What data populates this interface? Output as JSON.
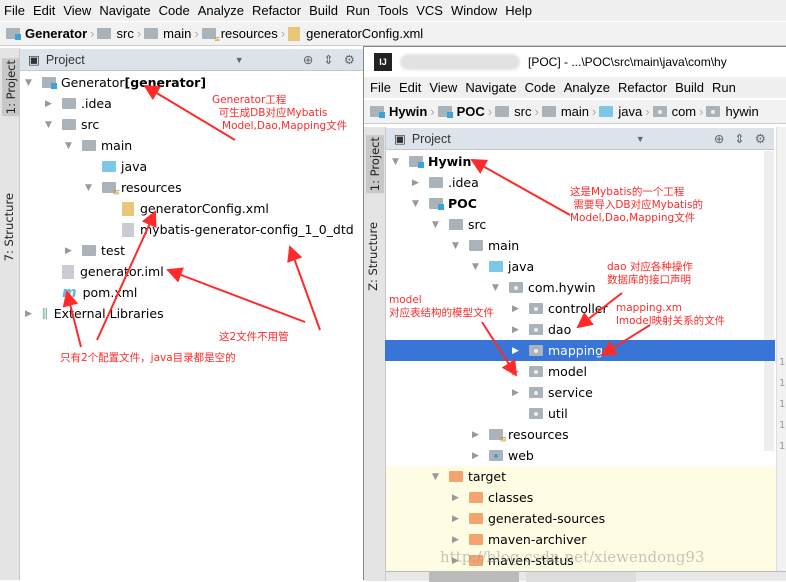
{
  "left": {
    "menu": [
      "File",
      "Edit",
      "View",
      "Navigate",
      "Code",
      "Analyze",
      "Refactor",
      "Build",
      "Run",
      "Tools",
      "VCS",
      "Window",
      "Help"
    ],
    "breadcrumb": [
      {
        "label": "Generator",
        "icon": "module",
        "bold": true
      },
      {
        "label": "src",
        "icon": "folder"
      },
      {
        "label": "main",
        "icon": "folder"
      },
      {
        "label": "resources",
        "icon": "res"
      },
      {
        "label": "generatorConfig.xml",
        "icon": "xml"
      }
    ],
    "panel_title": "Project",
    "side_tabs": [
      "1: Project",
      "7: Structure"
    ],
    "tree": [
      {
        "label": "Generator",
        "suffix": " [generator]",
        "level": 0,
        "state": "open",
        "icon": "mod"
      },
      {
        "label": ".idea",
        "level": 1,
        "state": "closed",
        "icon": "folder"
      },
      {
        "label": "src",
        "level": 1,
        "state": "open",
        "icon": "folder"
      },
      {
        "label": "main",
        "level": 2,
        "state": "open",
        "icon": "folder"
      },
      {
        "label": "java",
        "level": 3,
        "state": "none",
        "icon": "blue"
      },
      {
        "label": "resources",
        "level": 3,
        "state": "open",
        "icon": "res"
      },
      {
        "label": "generatorConfig.xml",
        "level": 4,
        "state": "none",
        "icon": "xml"
      },
      {
        "label": "mybatis-generator-config_1_0_dtd",
        "level": 4,
        "state": "none",
        "icon": "file"
      },
      {
        "label": "test",
        "level": 2,
        "state": "closed",
        "icon": "folder"
      },
      {
        "label": "generator.iml",
        "level": 1,
        "state": "none",
        "icon": "file"
      },
      {
        "label": "pom.xml",
        "level": 1,
        "state": "none",
        "icon": "maven"
      },
      {
        "label": "External Libraries",
        "level": 0,
        "state": "closed",
        "icon": "libs"
      }
    ]
  },
  "right": {
    "title": "[POC] - ...\\POC\\src\\main\\java\\com\\hy",
    "menu": [
      "File",
      "Edit",
      "View",
      "Navigate",
      "Code",
      "Analyze",
      "Refactor",
      "Build",
      "Run"
    ],
    "breadcrumb": [
      {
        "label": "Hywin",
        "icon": "module",
        "bold": true
      },
      {
        "label": "POC",
        "icon": "module",
        "bold": true
      },
      {
        "label": "src",
        "icon": "folder"
      },
      {
        "label": "main",
        "icon": "folder"
      },
      {
        "label": "java",
        "icon": "blue"
      },
      {
        "label": "com",
        "icon": "pkg"
      },
      {
        "label": "hywin",
        "icon": "pkg"
      }
    ],
    "panel_title": "Project",
    "side_tabs": [
      "1: Project",
      "Z: Structure"
    ],
    "tree": [
      {
        "label": "Hywin",
        "level": 0,
        "state": "open",
        "icon": "mod",
        "bold": true
      },
      {
        "label": ".idea",
        "level": 1,
        "state": "closed",
        "icon": "folder"
      },
      {
        "label": "POC",
        "level": 1,
        "state": "open",
        "icon": "mod",
        "bold": true
      },
      {
        "label": "src",
        "level": 2,
        "state": "open",
        "icon": "folder"
      },
      {
        "label": "main",
        "level": 3,
        "state": "open",
        "icon": "folder"
      },
      {
        "label": "java",
        "level": 4,
        "state": "open",
        "icon": "blue"
      },
      {
        "label": "com.hywin",
        "level": 5,
        "state": "open",
        "icon": "pkg"
      },
      {
        "label": "controller",
        "level": 6,
        "state": "closed",
        "icon": "pkg"
      },
      {
        "label": "dao",
        "level": 6,
        "state": "closed",
        "icon": "pkg"
      },
      {
        "label": "mapping",
        "level": 6,
        "state": "closed",
        "icon": "pkg",
        "selected": true
      },
      {
        "label": "model",
        "level": 6,
        "state": "closed",
        "icon": "pkg"
      },
      {
        "label": "service",
        "level": 6,
        "state": "closed",
        "icon": "pkg"
      },
      {
        "label": "util",
        "level": 6,
        "state": "none",
        "icon": "pkg"
      },
      {
        "label": "resources",
        "level": 4,
        "state": "closed",
        "icon": "res"
      },
      {
        "label": "web",
        "level": 4,
        "state": "closed",
        "icon": "web"
      },
      {
        "label": "target",
        "level": 2,
        "state": "open",
        "icon": "orange",
        "excluded": true
      },
      {
        "label": "classes",
        "level": 3,
        "state": "closed",
        "icon": "orange",
        "excluded": true
      },
      {
        "label": "generated-sources",
        "level": 3,
        "state": "closed",
        "icon": "orange",
        "excluded": true
      },
      {
        "label": "maven-archiver",
        "level": 3,
        "state": "closed",
        "icon": "orange",
        "excluded": true
      },
      {
        "label": "maven-status",
        "level": 3,
        "state": "closed",
        "icon": "orange",
        "excluded": true
      }
    ],
    "gutter": [
      "1",
      "1",
      "1",
      "1",
      "1"
    ]
  },
  "annotations": {
    "generator": "Generator工程\n  可生成DB对应Mybatis\n   Model,Dao,Mapping文件",
    "ignore": "这2文件不用管",
    "only_two": "只有2个配置文件，java目录都是空的",
    "mybatis": "这是Mybatis的一个工程\n 需要导入DB对应Mybatis的\nModel,Dao,Mapping文件",
    "dao": "dao 对应各种操作\n数据库的接口声明",
    "model": "model\n对应表结构的模型文件",
    "mapping": "mapping.xm\nlmodel映射关系的文件"
  },
  "watermark": "http://blog.csdn.net/xiewendong93",
  "colors": {
    "annotation": "#ff2a2a",
    "selection": "#3875d7",
    "excluded_bg": "#fefde3"
  }
}
